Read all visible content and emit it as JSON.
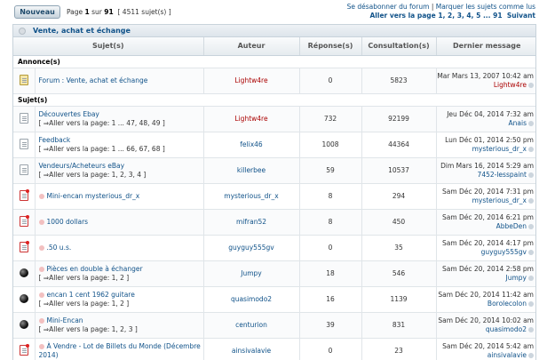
{
  "top": {
    "new_button": "Nouveau",
    "page_prefix": "Page ",
    "page_current": "1",
    "page_sep": " sur ",
    "page_total": "91",
    "topic_count": "[ 4511 sujet(s) ]",
    "unsubscribe": "Se désabonner du forum",
    "mark_read": "Marquer les sujets comme lus",
    "goto_label": "Aller vers la page",
    "goto_pages": [
      "1",
      "2",
      "3",
      "4",
      "5",
      "...",
      "91"
    ],
    "next": "Suivant"
  },
  "category": {
    "title": "Vente, achat et échange"
  },
  "columns": [
    "Sujet(s)",
    "Auteur",
    "Réponse(s)",
    "Consultation(s)",
    "Dernier message"
  ],
  "sections": {
    "announcements": "Annonce(s)",
    "topics": "Sujet(s)"
  },
  "announcement": {
    "icon": "announcement-icon",
    "title": "Forum : Vente, achat et échange",
    "author": "Lightw4re",
    "replies": "0",
    "views": "5823",
    "last_date": "Mar Mars 13, 2007 10:42 am",
    "last_by": "Lightw4re"
  },
  "topics": [
    {
      "icon": "topic-icon",
      "title": "Découvertes Ebay",
      "pages": "[ ⇒Aller vers la page: 1 ... 47, 48, 49 ]",
      "author": "Lightw4re",
      "author_red": true,
      "replies": "732",
      "views": "92199",
      "last_date": "Jeu Déc 04, 2014 7:32 am",
      "last_by": "Anais",
      "last_red": false
    },
    {
      "icon": "topic-icon",
      "title": "Feedback",
      "pages": "[ ⇒Aller vers la page: 1 ... 66, 67, 68 ]",
      "author": "felix46",
      "author_red": false,
      "replies": "1008",
      "views": "44364",
      "last_date": "Lun Déc 01, 2014 2:50 pm",
      "last_by": "mysterious_dr_x",
      "last_red": false
    },
    {
      "icon": "topic-icon",
      "title": "Vendeurs/Acheteurs eBay",
      "pages": "[ ⇒Aller vers la page: 1, 2, 3, 4 ]",
      "author": "killerbee",
      "author_red": false,
      "replies": "59",
      "views": "10537",
      "last_date": "Dim Mars 16, 2014 5:29 am",
      "last_by": "7452-lesspaint",
      "last_red": false
    },
    {
      "icon": "hot-topic-icon",
      "title": "Mini-encan mysterious_dr_x",
      "pages": "",
      "author": "mysterious_dr_x",
      "author_red": false,
      "replies": "8",
      "views": "294",
      "last_date": "Sam Déc 20, 2014 7:31 pm",
      "last_by": "mysterious_dr_x",
      "last_red": false
    },
    {
      "icon": "hot-topic-icon",
      "title": "1000 dollars",
      "pages": "",
      "author": "mifran52",
      "author_red": false,
      "replies": "8",
      "views": "450",
      "last_date": "Sam Déc 20, 2014 6:21 pm",
      "last_by": "AbbeDen",
      "last_red": false
    },
    {
      "icon": "hot-topic-icon",
      "title": ".50 u.s.",
      "pages": "",
      "author": "guyguy555gv",
      "author_red": false,
      "replies": "0",
      "views": "35",
      "last_date": "Sam Déc 20, 2014 4:17 pm",
      "last_by": "guyguy555gv",
      "last_red": false
    },
    {
      "icon": "ball-icon",
      "title": "Pièces en double à échanger",
      "pages": "[ ⇒Aller vers la page: 1, 2 ]",
      "author": "Jumpy",
      "author_red": false,
      "replies": "18",
      "views": "546",
      "last_date": "Sam Déc 20, 2014 2:58 pm",
      "last_by": "Jumpy",
      "last_red": false
    },
    {
      "icon": "ball-icon",
      "title": "encan 1 cent 1962 guitare",
      "pages": "[ ⇒Aller vers la page: 1, 2 ]",
      "author": "quasimodo2",
      "author_red": false,
      "replies": "16",
      "views": "1139",
      "last_date": "Sam Déc 20, 2014 11:42 am",
      "last_by": "Borolecolon",
      "last_red": false
    },
    {
      "icon": "ball-icon",
      "title": "Mini-Encan",
      "pages": "[ ⇒Aller vers la page: 1, 2, 3 ]",
      "author": "centurion",
      "author_red": false,
      "replies": "39",
      "views": "831",
      "last_date": "Sam Déc 20, 2014 10:02 am",
      "last_by": "quasimodo2",
      "last_red": false
    },
    {
      "icon": "hot-topic-icon",
      "title": "À Vendre - Lot de Billets du Monde (Décembre 2014)",
      "pages": "",
      "author": "ainsivalavie",
      "author_red": false,
      "replies": "0",
      "views": "23",
      "last_date": "Sam Déc 20, 2014 5:42 am",
      "last_by": "ainsivalavie",
      "last_red": false
    }
  ]
}
